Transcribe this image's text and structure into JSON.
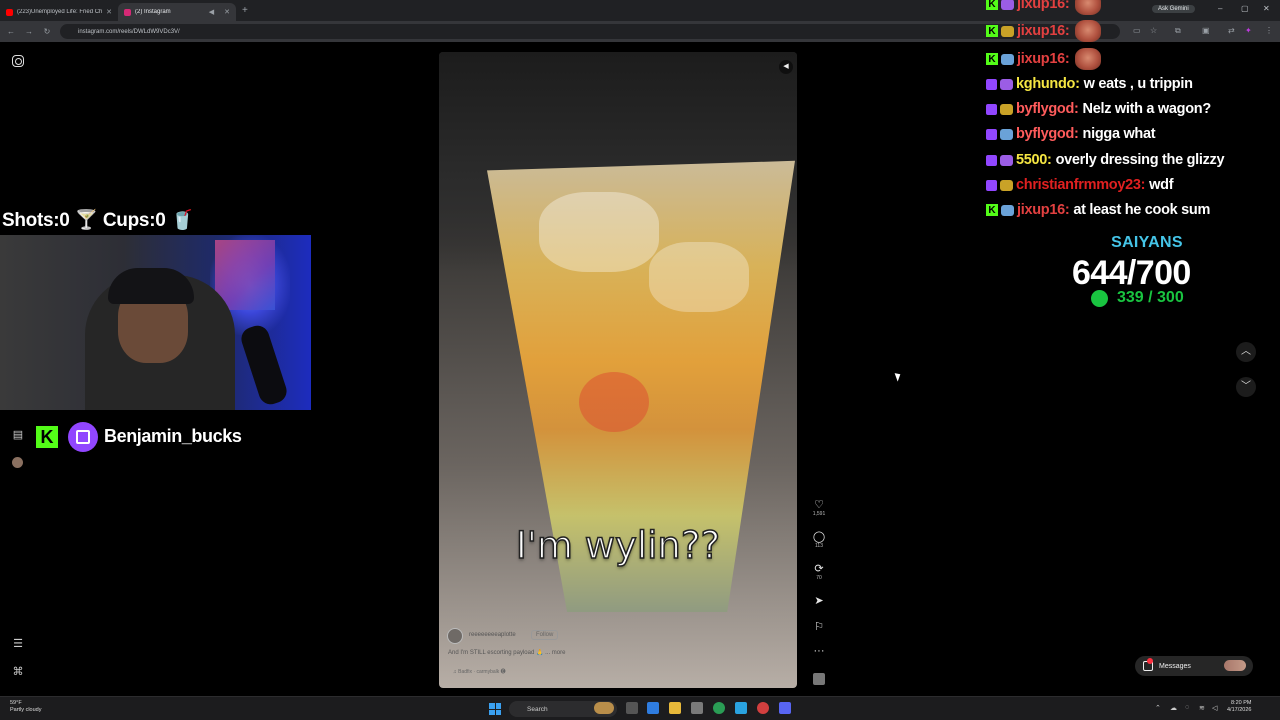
{
  "browser": {
    "tabs": [
      {
        "label": "(223)Unemployed Life: Fried Chi...",
        "active": false,
        "color": "#ff0000"
      },
      {
        "label": "(2) Instagram",
        "active": true,
        "color": "#d62976"
      }
    ],
    "url": "instagram.com/reels/DWLdW9VDc3V/",
    "gemini_label": "Ask Gemini"
  },
  "overlay": {
    "counter": "Shots:0 🍸 Cups:0 🥤",
    "streamer_name": "Benjamin_bucks"
  },
  "reel": {
    "caption": "I'm wylin??",
    "username": "reeeeeeeeaplotte",
    "follow_label": "Follow",
    "description": "And I'm STILL escorting payload 🙏 ... more",
    "audio": "♫ Badfix · carmybalk 🅔",
    "actions": [
      {
        "icon": "heart-icon",
        "glyph": "♡",
        "count": "1,591"
      },
      {
        "icon": "comment-icon",
        "glyph": "◯",
        "count": "113"
      },
      {
        "icon": "repost-icon",
        "glyph": "⟳",
        "count": "70"
      },
      {
        "icon": "share-icon",
        "glyph": "➤",
        "count": ""
      },
      {
        "icon": "bookmark-icon",
        "glyph": "⚐",
        "count": ""
      },
      {
        "icon": "more-icon",
        "glyph": "···",
        "count": ""
      }
    ]
  },
  "chat": [
    {
      "platform": "kick",
      "user": "jixup16:",
      "message": "",
      "user_color": "#e24040",
      "emote": true
    },
    {
      "platform": "kick",
      "user": "jixup16:",
      "message": "",
      "user_color": "#e24040",
      "emote": true
    },
    {
      "platform": "kick",
      "user": "jixup16:",
      "message": "",
      "user_color": "#e24040",
      "emote": true
    },
    {
      "platform": "twitch",
      "user": "kghundo:",
      "message": "w eats , u trippin",
      "user_color": "#f5e642",
      "emote": false
    },
    {
      "platform": "twitch",
      "user": "byflygod:",
      "message": "Nelz with a wagon?",
      "user_color": "#ff5c5c",
      "emote": false
    },
    {
      "platform": "twitch",
      "user": "byflygod:",
      "message": "nigga what",
      "user_color": "#ff5c5c",
      "emote": false
    },
    {
      "platform": "twitch",
      "user": "5500:",
      "message": "overly dressing the glizzy",
      "user_color": "#f5e642",
      "emote": false
    },
    {
      "platform": "twitch",
      "user": "christianfrmmoy23:",
      "message": "wdf",
      "user_color": "#e02020",
      "emote": false
    },
    {
      "platform": "kick",
      "user": "jixup16:",
      "message": "at least he cook sum",
      "user_color": "#e24040",
      "emote": false
    }
  ],
  "goal": {
    "title": "SAIYANS",
    "score": "644/700",
    "sub_score": "339 / 300"
  },
  "messages_label": "Messages",
  "taskbar": {
    "weather_temp": "59°F",
    "weather_desc": "Partly cloudy",
    "search_label": "Search",
    "time": "8:20 PM",
    "date": "4/17/2026"
  }
}
